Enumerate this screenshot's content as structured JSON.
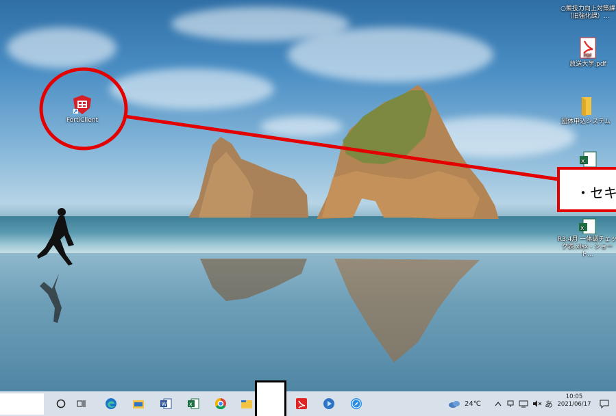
{
  "desktop": {
    "icons": [
      {
        "name": "forticlient",
        "label": "FortiClient"
      },
      {
        "name": "folder-top",
        "label": "○競技力向上対策課（旧強化課）..."
      },
      {
        "name": "pdf",
        "label": "放送大学.pdf"
      },
      {
        "name": "folder",
        "label": "団体申込システム"
      },
      {
        "name": "excel-a",
        "label": ""
      },
      {
        "name": "excel-b",
        "label": "R3.4月 一体調チェック表.xlsx - ショート..."
      }
    ],
    "callout_text": "・セキ"
  },
  "taskbar": {
    "apps": [
      "cortana-icon",
      "task-view-icon",
      "edge-icon",
      "explorer-icon",
      "word-icon",
      "excel-icon",
      "chrome-icon",
      "folder-icon",
      "pdf-icon",
      "app-icon",
      "safari-icon"
    ],
    "weather": "24℃",
    "ime": "あ",
    "clock_time": "10:05",
    "clock_date": "2021/06/17"
  },
  "colors": {
    "annotation": "#e30000",
    "taskbar": "#d8e1ea"
  }
}
